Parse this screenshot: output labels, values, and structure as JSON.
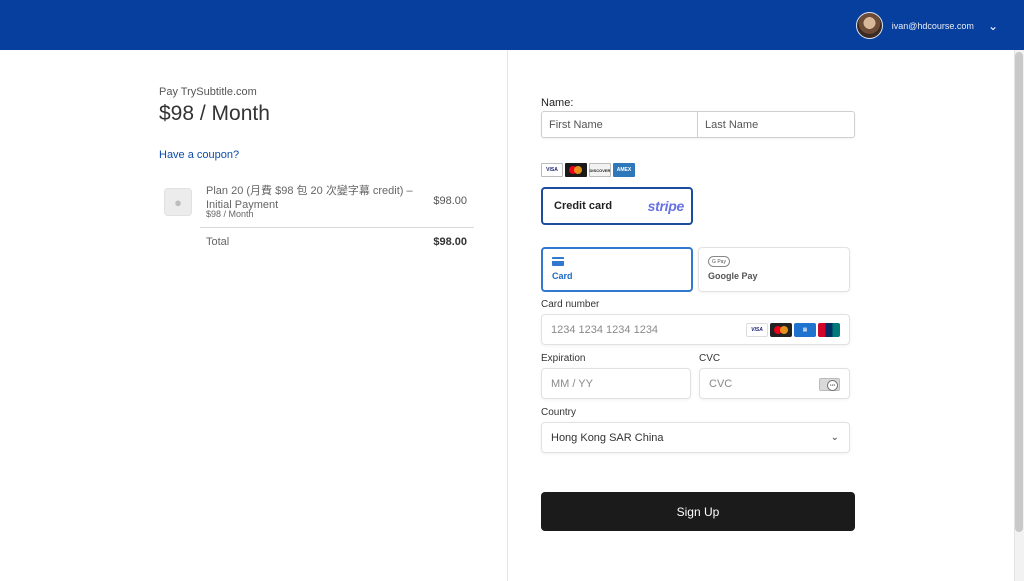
{
  "header": {
    "user_email": "ivan@hdcourse.com",
    "avatar": "user-avatar",
    "dropdown_icon": "chevron-down-icon"
  },
  "summary": {
    "pay_label": "Pay TrySubtitle.com",
    "price": "$98 / Month",
    "coupon_link": "Have a coupon?",
    "item": {
      "name": "Plan 20 (月費 $98 包 20 次變字幕 credit) – Initial Payment",
      "subline": "$98 / Month",
      "price": "$98.00",
      "thumbnail_icon": "product-placeholder-icon"
    },
    "total_label": "Total",
    "total_value": "$98.00"
  },
  "form": {
    "name_label": "Name:",
    "first_name_placeholder": "First Name",
    "last_name_placeholder": "Last Name",
    "accepted_brands": [
      "VISA",
      "MasterCard",
      "DISCOVER",
      "AMEX"
    ],
    "method_label": "Credit card",
    "method_provider": "stripe",
    "tabs": {
      "card": "Card",
      "google_pay": "Google Pay",
      "gpay_badge": "G Pay"
    },
    "card_number_label": "Card number",
    "card_number_placeholder": "1234 1234 1234 1234",
    "card_brands": [
      "VISA",
      "MasterCard",
      "AMEX",
      "UnionPay"
    ],
    "expiration_label": "Expiration",
    "expiration_placeholder": "MM / YY",
    "cvc_label": "CVC",
    "cvc_placeholder": "CVC",
    "country_label": "Country",
    "country_value": "Hong Kong SAR China",
    "submit_label": "Sign Up"
  },
  "colors": {
    "header_bg": "#073f9e",
    "link": "#0c4ba8",
    "active_tab": "#3078d0",
    "stripe": "#6772e5",
    "button_bg": "#1b1b1b"
  }
}
